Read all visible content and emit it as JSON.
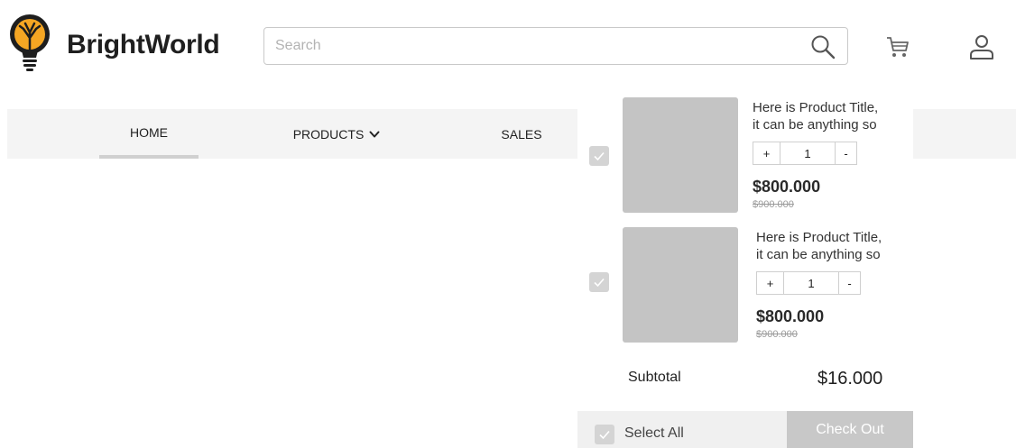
{
  "brand": {
    "name": "BrightWorld",
    "logo_icon": "lightbulb-tree-icon",
    "logo_color": "#F5A623"
  },
  "search": {
    "placeholder": "Search",
    "value": ""
  },
  "nav": {
    "items": [
      {
        "label": "HOME",
        "active": true
      },
      {
        "label": "PRODUCTS",
        "has_dropdown": true
      },
      {
        "label": "SALES"
      }
    ]
  },
  "cart": {
    "items": [
      {
        "title_line1": "Here is Product Title,",
        "title_line2": "it can be anything so",
        "quantity": "1",
        "price": "$800.000",
        "old_price": "$900.000",
        "checked": true,
        "plus": "+",
        "minus": "-"
      },
      {
        "title_line1": "Here is Product Title,",
        "title_line2": "it can be anything so",
        "quantity": "1",
        "price": "$800.000",
        "old_price": "$900.000",
        "checked": true,
        "plus": "+",
        "minus": "-"
      }
    ],
    "subtotal_label": "Subtotal",
    "subtotal_value": "$16.000",
    "select_all_label": "Select All",
    "checkout_label": "Check Out"
  },
  "colors": {
    "checkout_bg": "#C8C8C8",
    "nav_bg": "#F4F4F4",
    "placeholder_image": "#C4C4C4"
  }
}
